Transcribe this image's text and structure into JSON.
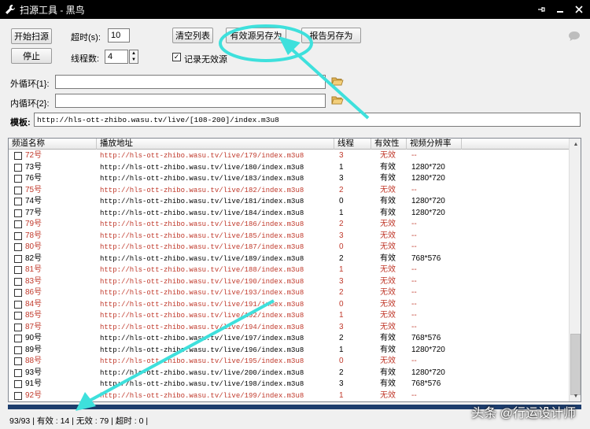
{
  "window": {
    "title": "扫源工具 - 黑鸟"
  },
  "toolbar": {
    "start_label": "开始扫源",
    "stop_label": "停止",
    "timeout_label": "超时(s):",
    "timeout_value": "10",
    "threads_label": "线程数:",
    "threads_value": "4",
    "clear_label": "清空列表",
    "save_valid_label": "有效源另存为",
    "save_report_label": "报告另存为",
    "record_invalid_label": "记录无效源",
    "record_invalid_checked": "✓"
  },
  "loops": {
    "outer_label": "外循环{1}:",
    "outer_value": "",
    "inner_label": "内循环{2}:",
    "inner_value": ""
  },
  "template": {
    "label": "模板:",
    "value": "http://hls-ott-zhibo.wasu.tv/live/[108-200]/index.m3u8"
  },
  "table": {
    "headers": [
      "频道名称",
      "播放地址",
      "线程",
      "有效性",
      "视频分辨率"
    ],
    "rows": [
      {
        "name": "72号",
        "url": "http://hls-ott-zhibo.wasu.tv/live/179/index.m3u8",
        "thread": "3",
        "valid": "无效",
        "res": "--",
        "invalid": true
      },
      {
        "name": "73号",
        "url": "http://hls-ott-zhibo.wasu.tv/live/180/index.m3u8",
        "thread": "1",
        "valid": "有效",
        "res": "1280*720",
        "invalid": false
      },
      {
        "name": "76号",
        "url": "http://hls-ott-zhibo.wasu.tv/live/183/index.m3u8",
        "thread": "3",
        "valid": "有效",
        "res": "1280*720",
        "invalid": false
      },
      {
        "name": "75号",
        "url": "http://hls-ott-zhibo.wasu.tv/live/182/index.m3u8",
        "thread": "2",
        "valid": "无效",
        "res": "--",
        "invalid": true
      },
      {
        "name": "74号",
        "url": "http://hls-ott-zhibo.wasu.tv/live/181/index.m3u8",
        "thread": "0",
        "valid": "有效",
        "res": "1280*720",
        "invalid": false
      },
      {
        "name": "77号",
        "url": "http://hls-ott-zhibo.wasu.tv/live/184/index.m3u8",
        "thread": "1",
        "valid": "有效",
        "res": "1280*720",
        "invalid": false
      },
      {
        "name": "79号",
        "url": "http://hls-ott-zhibo.wasu.tv/live/186/index.m3u8",
        "thread": "2",
        "valid": "无效",
        "res": "--",
        "invalid": true
      },
      {
        "name": "78号",
        "url": "http://hls-ott-zhibo.wasu.tv/live/185/index.m3u8",
        "thread": "3",
        "valid": "无效",
        "res": "--",
        "invalid": true
      },
      {
        "name": "80号",
        "url": "http://hls-ott-zhibo.wasu.tv/live/187/index.m3u8",
        "thread": "0",
        "valid": "无效",
        "res": "--",
        "invalid": true
      },
      {
        "name": "82号",
        "url": "http://hls-ott-zhibo.wasu.tv/live/189/index.m3u8",
        "thread": "2",
        "valid": "有效",
        "res": "768*576",
        "invalid": false
      },
      {
        "name": "81号",
        "url": "http://hls-ott-zhibo.wasu.tv/live/188/index.m3u8",
        "thread": "1",
        "valid": "无效",
        "res": "--",
        "invalid": true
      },
      {
        "name": "83号",
        "url": "http://hls-ott-zhibo.wasu.tv/live/190/index.m3u8",
        "thread": "3",
        "valid": "无效",
        "res": "--",
        "invalid": true
      },
      {
        "name": "86号",
        "url": "http://hls-ott-zhibo.wasu.tv/live/193/index.m3u8",
        "thread": "2",
        "valid": "无效",
        "res": "--",
        "invalid": true
      },
      {
        "name": "84号",
        "url": "http://hls-ott-zhibo.wasu.tv/live/191/index.m3u8",
        "thread": "0",
        "valid": "无效",
        "res": "--",
        "invalid": true
      },
      {
        "name": "85号",
        "url": "http://hls-ott-zhibo.wasu.tv/live/192/index.m3u8",
        "thread": "1",
        "valid": "无效",
        "res": "--",
        "invalid": true
      },
      {
        "name": "87号",
        "url": "http://hls-ott-zhibo.wasu.tv/live/194/index.m3u8",
        "thread": "3",
        "valid": "无效",
        "res": "--",
        "invalid": true
      },
      {
        "name": "90号",
        "url": "http://hls-ott-zhibo.wasu.tv/live/197/index.m3u8",
        "thread": "2",
        "valid": "有效",
        "res": "768*576",
        "invalid": false
      },
      {
        "name": "89号",
        "url": "http://hls-ott-zhibo.wasu.tv/live/196/index.m3u8",
        "thread": "1",
        "valid": "有效",
        "res": "1280*720",
        "invalid": false
      },
      {
        "name": "88号",
        "url": "http://hls-ott-zhibo.wasu.tv/live/195/index.m3u8",
        "thread": "0",
        "valid": "无效",
        "res": "--",
        "invalid": true
      },
      {
        "name": "93号",
        "url": "http://hls-ott-zhibo.wasu.tv/live/200/index.m3u8",
        "thread": "2",
        "valid": "有效",
        "res": "1280*720",
        "invalid": false
      },
      {
        "name": "91号",
        "url": "http://hls-ott-zhibo.wasu.tv/live/198/index.m3u8",
        "thread": "3",
        "valid": "有效",
        "res": "768*576",
        "invalid": false
      },
      {
        "name": "92号",
        "url": "http://hls-ott-zhibo.wasu.tv/live/199/index.m3u8",
        "thread": "1",
        "valid": "无效",
        "res": "--",
        "invalid": true
      }
    ]
  },
  "status": {
    "text": "93/93  | 有效 : 14 | 无效 : 79 | 超时 : 0 |"
  },
  "watermark": {
    "text": "头条 @行运设计师"
  },
  "colors": {
    "invalid": "#c0392b",
    "annotation": "#3ee0dc",
    "titlebar": "#000000",
    "progress": "#1d3d6d"
  },
  "icons": [
    "wrench-icon",
    "pin-icon",
    "minimize-icon",
    "maximize-icon",
    "close-icon",
    "chat-bubble-icon",
    "folder-icon"
  ]
}
